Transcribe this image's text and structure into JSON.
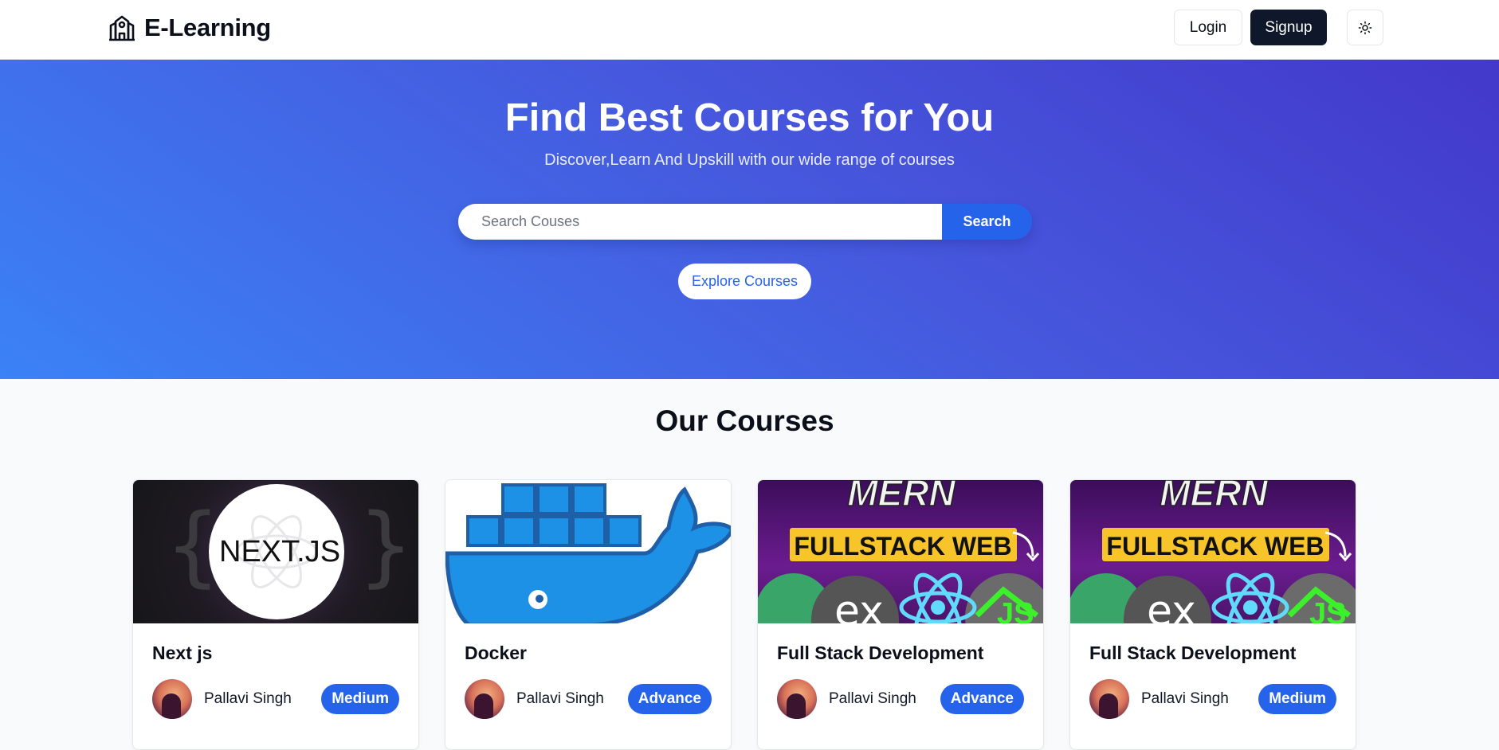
{
  "brand": {
    "name": "E-Learning",
    "icon": "school-icon"
  },
  "nav": {
    "login_label": "Login",
    "signup_label": "Signup",
    "theme_icon": "sun-icon"
  },
  "hero": {
    "title": "Find Best Courses for You",
    "subtitle": "Discover,Learn And Upskill with our wide range of courses",
    "search_placeholder": "Search Couses",
    "search_button": "Search",
    "explore_button": "Explore Courses"
  },
  "courses": {
    "title": "Our Courses",
    "items": [
      {
        "title": "Next js",
        "author": "Pallavi Singh",
        "level": "Medium",
        "thumb_text": "NEXT.JS"
      },
      {
        "title": "Docker",
        "author": "Pallavi Singh",
        "level": "Advance"
      },
      {
        "title": "Full Stack Development",
        "author": "Pallavi Singh",
        "level": "Advance",
        "thumb_text": [
          "MERN",
          "FULLSTACK WEB"
        ]
      },
      {
        "title": "Full Stack Development",
        "author": "Pallavi Singh",
        "level": "Medium",
        "thumb_text": [
          "MERN",
          "FULLSTACK WEB"
        ]
      }
    ]
  },
  "colors": {
    "primary": "#2563eb",
    "dark": "#0f172a",
    "hero_start": "#3b82f6",
    "hero_end": "#4338ca"
  }
}
